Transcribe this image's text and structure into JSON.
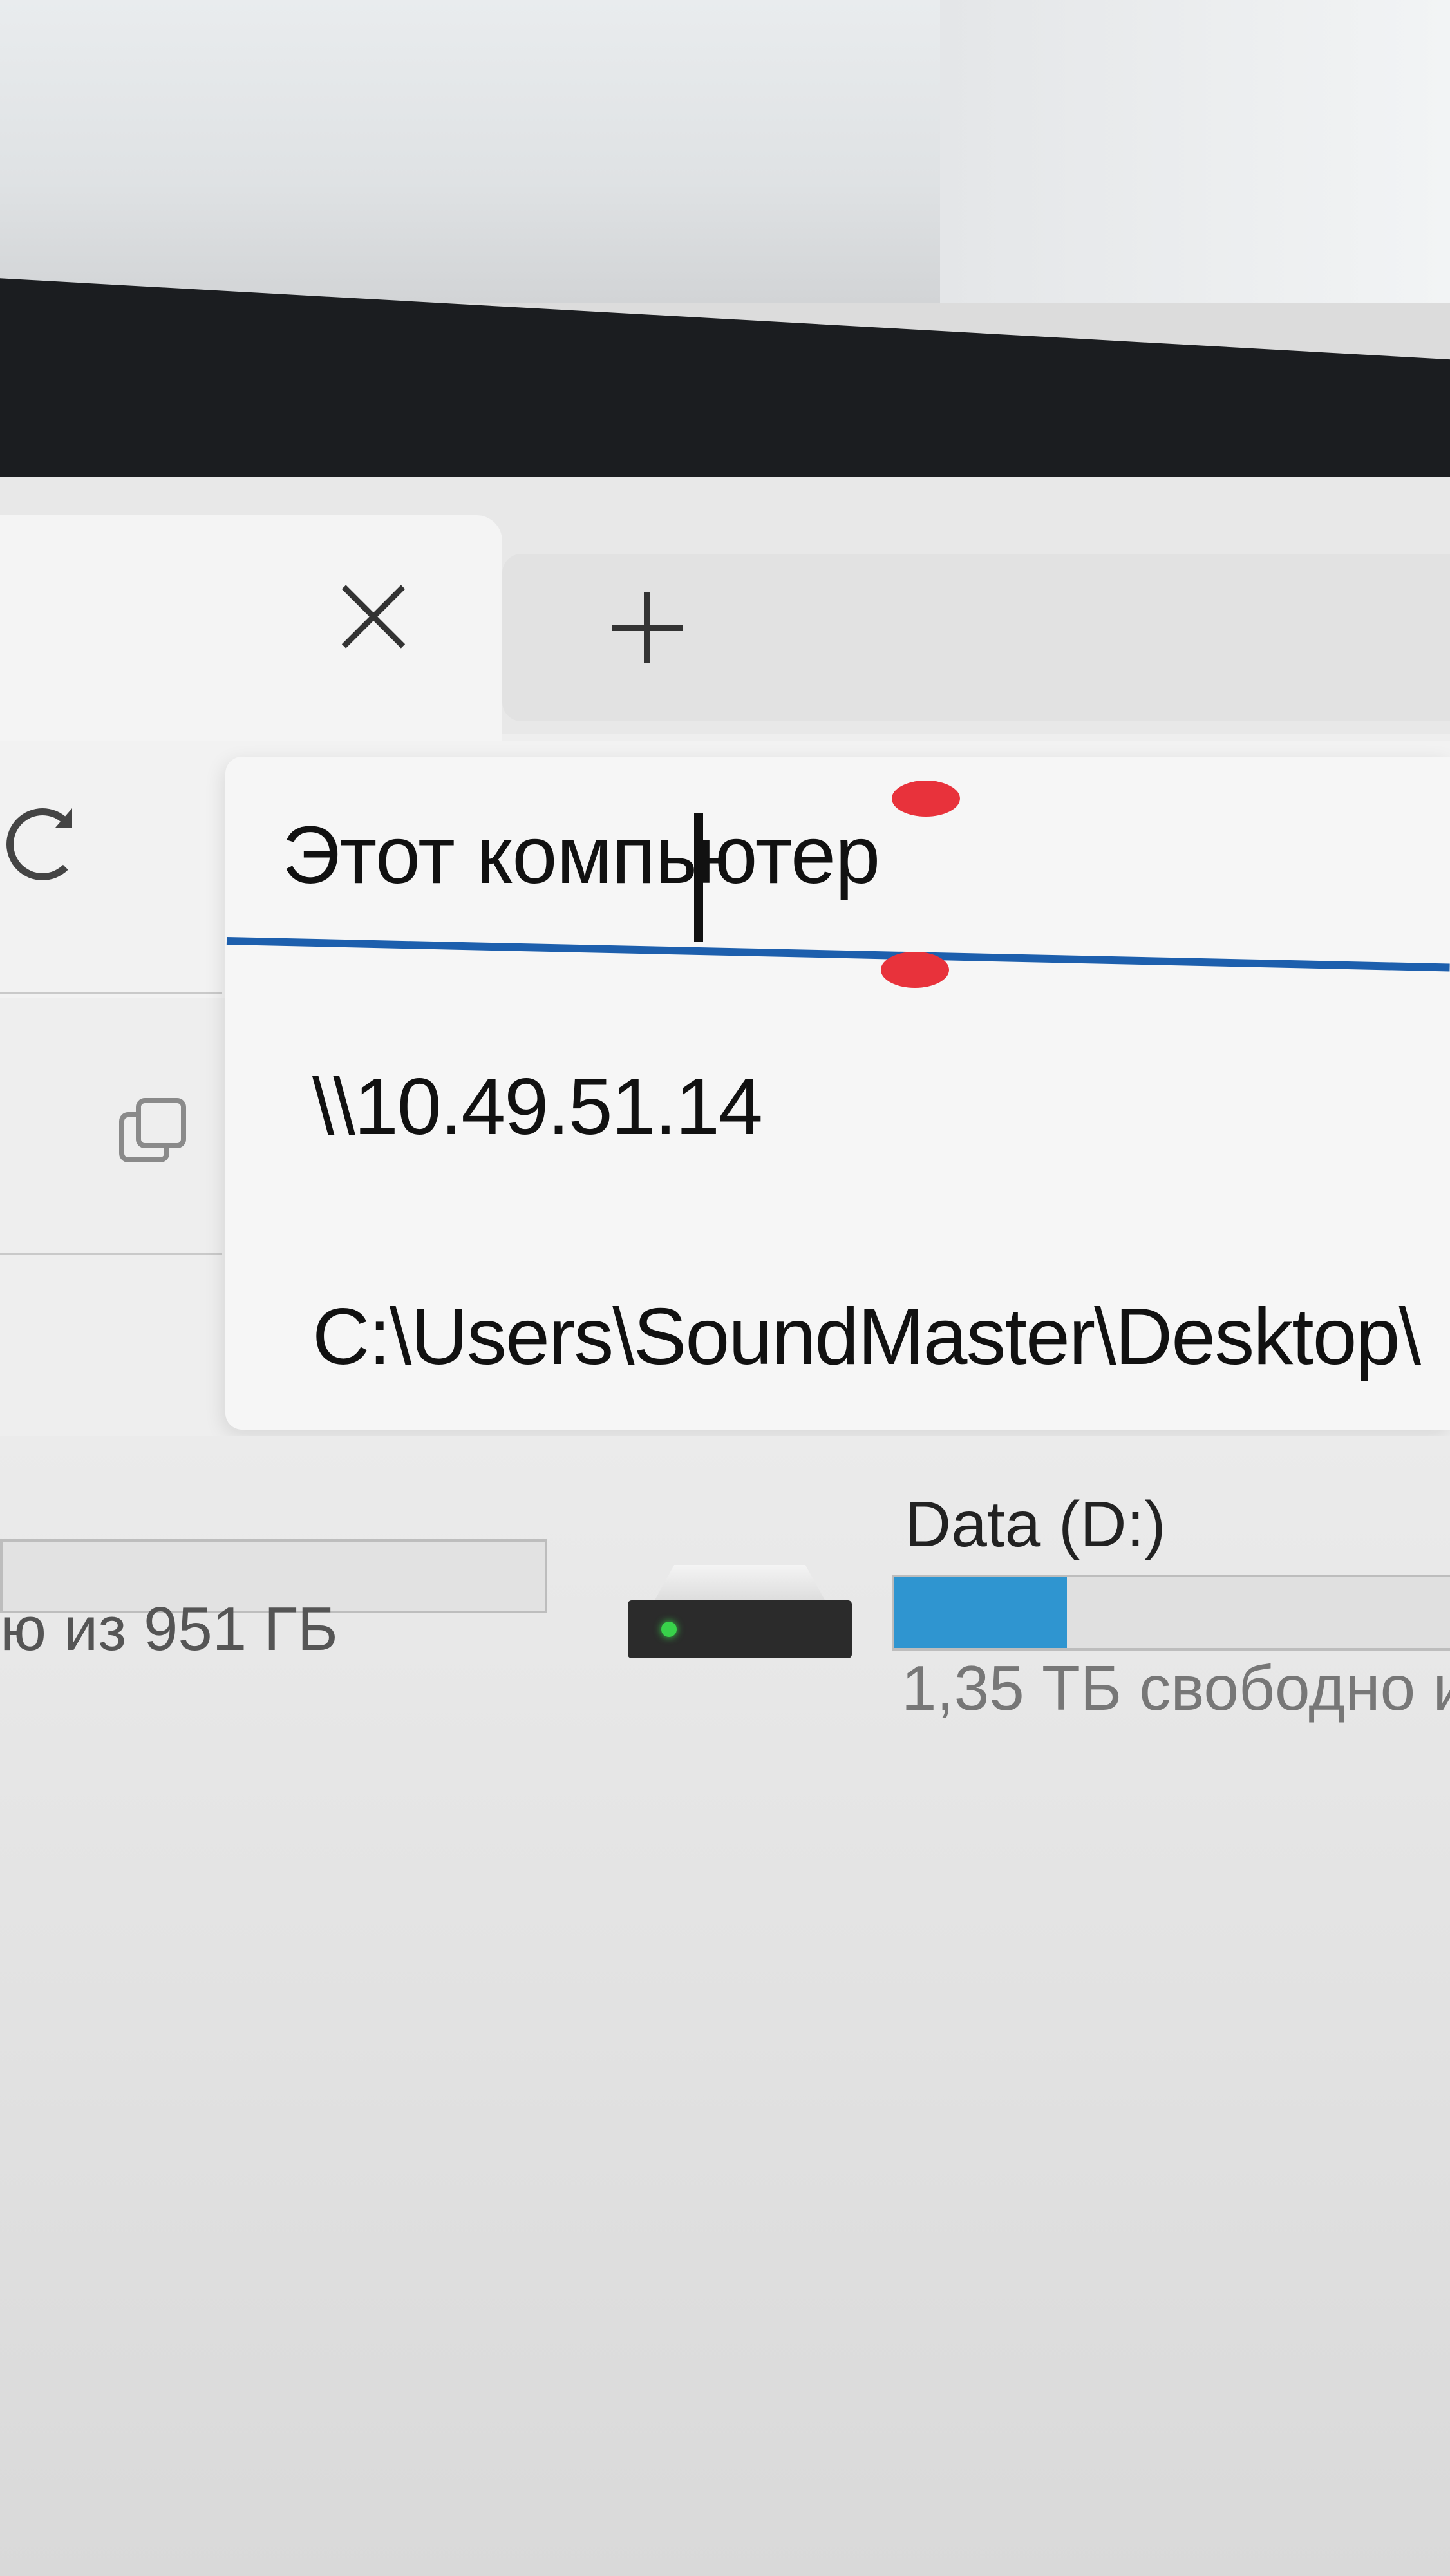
{
  "address_bar": {
    "value": "Этот компьютер"
  },
  "suggestions": [
    {
      "label": "\\\\10.49.51.14"
    },
    {
      "label": "C:\\Users\\SoundMaster\\Desktop\\"
    }
  ],
  "drives": {
    "c": {
      "caption": "ю из 951 ГБ"
    },
    "d": {
      "label": "Data (D:)",
      "caption": "1,35 ТБ свободно и",
      "usage_fraction": 0.3
    }
  },
  "colors": {
    "accent_underline": "#1d5fad",
    "usage_bar": "#2f95d0",
    "selection_handle": "#e8323b",
    "drive_led": "#38d24a"
  },
  "icons": [
    "close-icon",
    "plus-icon",
    "refresh-icon",
    "copy-icon",
    "drive-icon"
  ]
}
